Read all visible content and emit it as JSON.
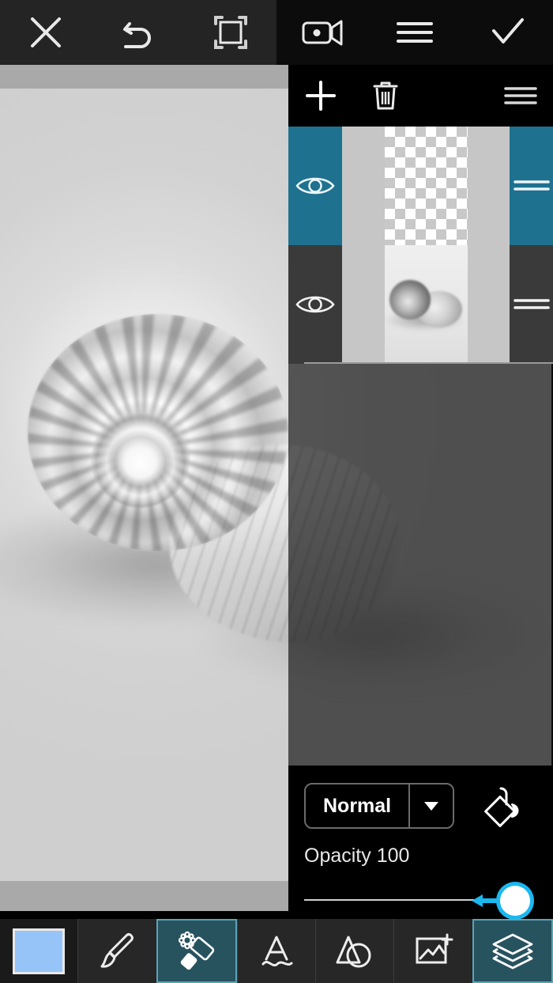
{
  "app": {
    "name": "mobile-photo-editor",
    "accent_teal": "#1e718f",
    "accent_teal_dark": "#27535f",
    "accent_cyan": "#1bb8f0",
    "swatch_color": "#96c4f8",
    "panel_black": "#000000",
    "toolbar_gray": "#242424"
  },
  "topbar": {
    "buttons": [
      {
        "name": "close",
        "icon": "close-x-icon",
        "label": "Close"
      },
      {
        "name": "undo",
        "icon": "undo-arrow-icon",
        "label": "Undo"
      },
      {
        "name": "crop",
        "icon": "crop-frame-icon",
        "label": "Crop / Transform"
      },
      {
        "name": "record",
        "icon": "video-camera-icon",
        "label": "Record"
      },
      {
        "name": "menu",
        "icon": "hamburger-menu-icon",
        "label": "Menu"
      },
      {
        "name": "confirm",
        "icon": "checkmark-icon",
        "label": "Confirm"
      }
    ]
  },
  "layers_panel": {
    "header": {
      "add_label": "Add layer",
      "add_icon": "plus-icon",
      "delete_label": "Delete layer",
      "delete_icon": "trash-icon",
      "menu_label": "Layer menu",
      "menu_icon": "hamburger-menu-icon"
    },
    "layers": [
      {
        "index": 0,
        "selected": true,
        "visible": true,
        "thumbnail_type": "transparent-checkerboard",
        "visibility_icon": "eye-icon",
        "drag_icon": "drag-handle-icon"
      },
      {
        "index": 1,
        "selected": false,
        "visible": true,
        "thumbnail_type": "snail-shell-photo",
        "visibility_icon": "eye-icon",
        "drag_icon": "drag-handle-icon"
      }
    ],
    "blend": {
      "mode_label": "Normal",
      "caret_icon": "chevron-down-icon",
      "clipping_icon": "clipping-mask-icon",
      "clipping_label": "Clipping mask"
    },
    "opacity": {
      "label": "Opacity 100",
      "value": 100,
      "min": 0,
      "max": 100,
      "drag_hint_icon": "left-arrow-icon"
    }
  },
  "canvas": {
    "image_description": "Grayscale photo of two snail shells on a light surface",
    "band_color": "#a9a9a9"
  },
  "bottombar": {
    "tools": [
      {
        "name": "color-swatch",
        "icon": "color-swatch-icon",
        "label": "Color",
        "active": false
      },
      {
        "name": "brush",
        "icon": "paintbrush-icon",
        "label": "Brush",
        "active": false
      },
      {
        "name": "eraser",
        "icon": "eraser-icon",
        "label": "Eraser",
        "active": true
      },
      {
        "name": "text",
        "icon": "text-a-icon",
        "label": "Text",
        "active": false
      },
      {
        "name": "shapes",
        "icon": "shapes-icon",
        "label": "Shapes",
        "active": false
      },
      {
        "name": "add-image",
        "icon": "add-image-icon",
        "label": "Add image",
        "active": false
      },
      {
        "name": "layers",
        "icon": "layers-stack-icon",
        "label": "Layers",
        "active": true
      }
    ]
  }
}
